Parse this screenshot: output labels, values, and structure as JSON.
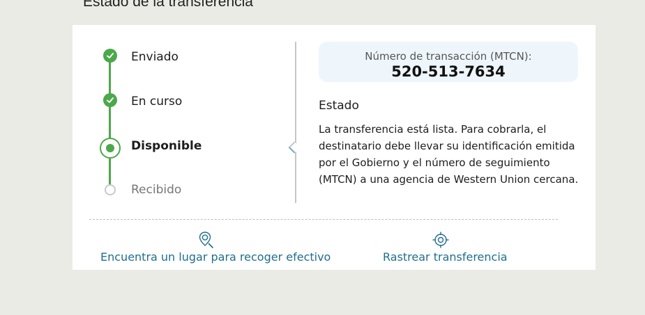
{
  "page": {
    "heading": "Estado de la transferencia"
  },
  "tracker": {
    "steps": [
      {
        "label": "Enviado",
        "state": "complete"
      },
      {
        "label": "En curso",
        "state": "complete"
      },
      {
        "label": "Disponible",
        "state": "current"
      },
      {
        "label": "Recibido",
        "state": "pending"
      }
    ]
  },
  "transaction": {
    "mtcn_label": "Número de transacción (MTCN):",
    "mtcn_value": "520-513-7634"
  },
  "status": {
    "title": "Estado",
    "description": "La transferencia está lista. Para cobrarla, el destinatario debe llevar su identificación emitida por el Gobierno y el número de seguimiento (MTCN) a una agencia de Western Union cercana."
  },
  "actions": {
    "find_location": {
      "label": "Encuentra un lugar para recoger efectivo",
      "icon": "location-search-icon"
    },
    "track_transfer": {
      "label": "Rastrear transferencia",
      "icon": "target-icon"
    }
  },
  "colors": {
    "success": "#4ca84a",
    "link": "#1f6e8c",
    "mtcn_background": "#eef6fc",
    "pending": "#c9c9c9"
  }
}
